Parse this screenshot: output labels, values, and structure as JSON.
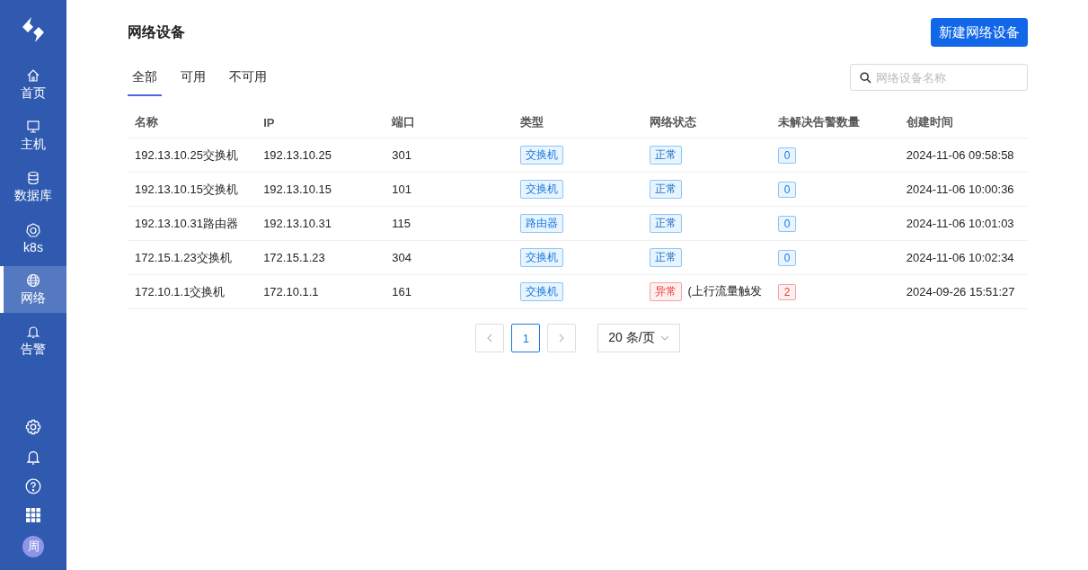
{
  "sidebar": {
    "items": [
      {
        "label": "首页",
        "kind": "home",
        "selected": false
      },
      {
        "label": "主机",
        "kind": "monitor",
        "selected": false
      },
      {
        "label": "数据库",
        "kind": "database",
        "selected": false
      },
      {
        "label": "k8s",
        "kind": "k8s",
        "selected": false
      },
      {
        "label": "网络",
        "kind": "globe",
        "selected": true
      },
      {
        "label": "告警",
        "kind": "bell",
        "selected": false
      }
    ],
    "avatar": "周"
  },
  "page": {
    "title": "网络设备",
    "new_button": "新建网络设备"
  },
  "tabs": [
    {
      "label": "全部",
      "selected": true
    },
    {
      "label": "可用",
      "selected": false
    },
    {
      "label": "不可用",
      "selected": false
    }
  ],
  "search": {
    "placeholder": "网络设备名称"
  },
  "table": {
    "columns": [
      "名称",
      "IP",
      "端口",
      "类型",
      "网络状态",
      "未解决告警数量",
      "创建时间"
    ],
    "rows": [
      {
        "name": "192.13.10.25交换机",
        "ip": "192.13.10.25",
        "port": "301",
        "type": "交换机",
        "status": "正常",
        "ok": true,
        "alarms": "0",
        "created": "2024-11-06 09:58:58"
      },
      {
        "name": "192.13.10.15交换机",
        "ip": "192.13.10.15",
        "port": "101",
        "type": "交换机",
        "status": "正常",
        "ok": true,
        "alarms": "0",
        "created": "2024-11-06 10:00:36"
      },
      {
        "name": "192.13.10.31路由器",
        "ip": "192.13.10.31",
        "port": "115",
        "type": "路由器",
        "status": "正常",
        "ok": true,
        "alarms": "0",
        "created": "2024-11-06 10:01:03"
      },
      {
        "name": "172.15.1.23交换机",
        "ip": "172.15.1.23",
        "port": "304",
        "type": "交换机",
        "status": "正常",
        "ok": true,
        "alarms": "0",
        "created": "2024-11-06 10:02:34"
      },
      {
        "name": "172.10.1.1交换机",
        "ip": "172.10.1.1",
        "port": "161",
        "type": "交换机",
        "status": "异常",
        "ok": false,
        "note": "(上行流量触发",
        "alarms": "2",
        "created": "2024-09-26 15:51:27"
      }
    ]
  },
  "pagination": {
    "pages": [
      {
        "label": "1",
        "selected": true
      }
    ],
    "page_size": "20 条/页"
  }
}
